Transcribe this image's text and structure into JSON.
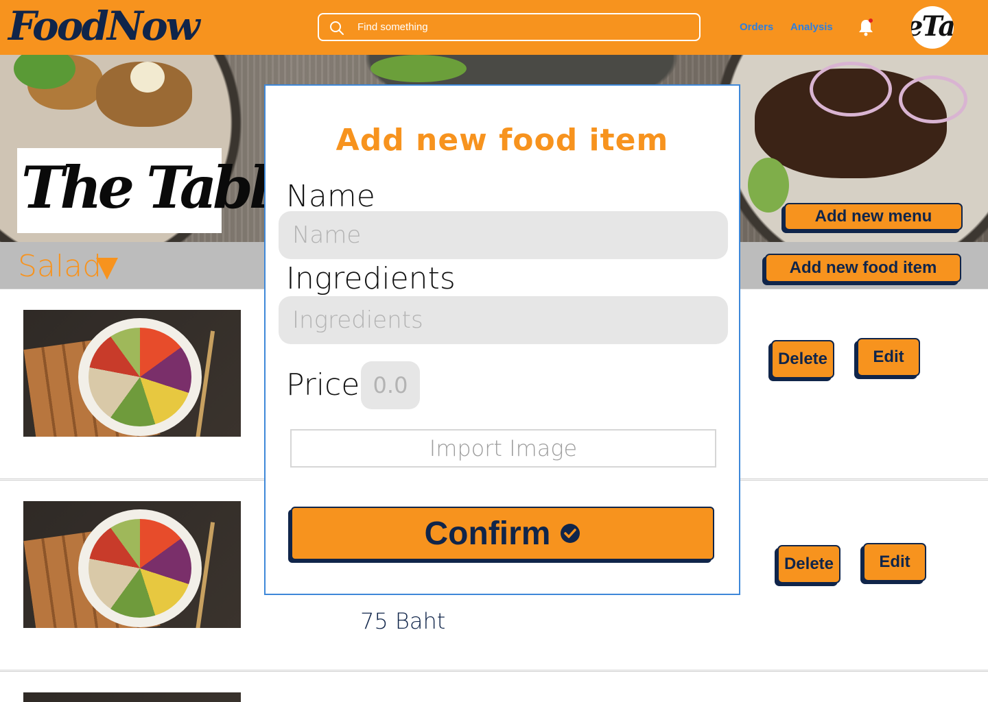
{
  "app": {
    "logo_text": "FoodNow"
  },
  "header": {
    "search_placeholder": "Find something",
    "nav": [
      "Orders",
      "Analysis"
    ],
    "avatar_text": "eTal"
  },
  "hero": {
    "restaurant_logo_text": "The Table",
    "add_menu_label": "Add new menu"
  },
  "category": {
    "label": "Salad",
    "add_food_label": "Add new food item"
  },
  "rows": [
    {
      "price": "",
      "delete_label": "Delete",
      "edit_label": "Edit"
    },
    {
      "price": "75 Baht",
      "delete_label": "Delete",
      "edit_label": "Edit"
    }
  ],
  "modal": {
    "title": "Add new food item",
    "name_label": "Name",
    "name_placeholder": "Name",
    "ingredients_label": "Ingredients",
    "ingredients_placeholder": "Ingredients",
    "price_label": "Price",
    "price_placeholder": "0.0",
    "import_label": "Import Image",
    "confirm_label": "Confirm"
  },
  "icons": {
    "search": "search-icon",
    "bell": "bell-icon",
    "caret": "caret-down-icon",
    "check": "check-circle-icon"
  },
  "colors": {
    "accent": "#F7931E",
    "navy": "#10254a",
    "link": "#2D7FE0",
    "modal_border": "#3d87d8"
  }
}
